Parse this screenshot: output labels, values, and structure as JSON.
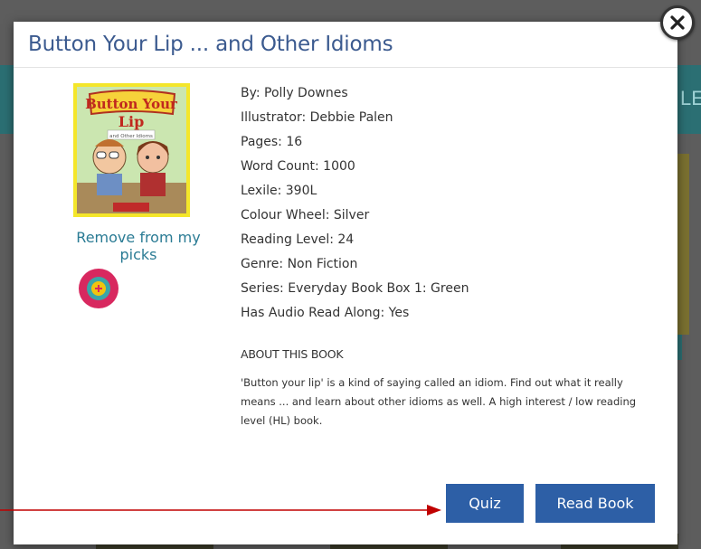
{
  "background": {
    "banner_fragment": "LE"
  },
  "modal": {
    "title": "Button Your Lip ... and Other Idioms",
    "cover": {
      "title_line1": "Button Your",
      "title_line2": "Lip",
      "subtitle": "and Other Idioms"
    },
    "remove_label": "Remove from my picks",
    "details": [
      "By: Polly Downes",
      "Illustrator: Debbie Palen",
      "Pages: 16",
      "Word Count: 1000",
      "Lexile: 390L",
      "Colour Wheel: Silver",
      "Reading Level: 24",
      "Genre: Non Fiction",
      "Series: Everyday Book Box 1: Green",
      "Has Audio Read Along: Yes"
    ],
    "about_heading": "ABOUT THIS BOOK",
    "about_text": "'Button your lip' is a kind of saying called an idiom. Find out what it really means ... and learn about other idioms as well. A high interest / low reading level (HL) book.",
    "buttons": {
      "quiz": "Quiz",
      "read": "Read Book"
    }
  },
  "colors": {
    "title": "#3b5a8f",
    "link": "#2a7b94",
    "button": "#2d5fa6",
    "arrow": "#c00000"
  },
  "icons": {
    "close": "close-x-icon",
    "audio": "audio-play-icon"
  }
}
